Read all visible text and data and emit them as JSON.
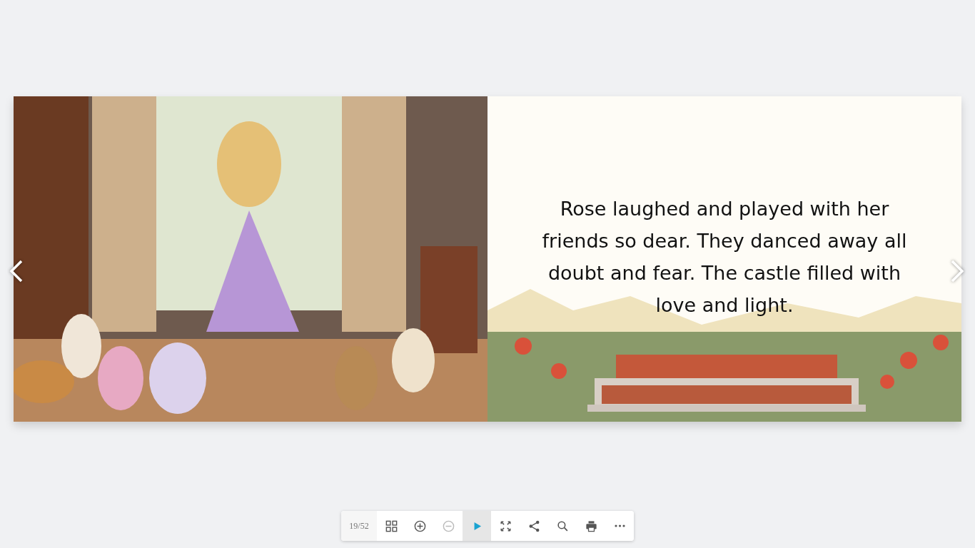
{
  "book": {
    "right_page": {
      "kind": "picture",
      "text": "Rose laughed and played with her friends so dear. They danced away all doubt and fear. The castle filled with love and light."
    }
  },
  "toolbar": {
    "page_counter": "19/52",
    "buttons": [
      {
        "kind": "grid",
        "disabled": false,
        "selected": false
      },
      {
        "kind": "zoom-in",
        "disabled": false,
        "selected": false
      },
      {
        "kind": "zoom-out",
        "disabled": true,
        "selected": false
      },
      {
        "kind": "play",
        "disabled": false,
        "selected": true
      },
      {
        "kind": "fullscreen",
        "disabled": false,
        "selected": false
      },
      {
        "kind": "share",
        "disabled": false,
        "selected": false
      },
      {
        "kind": "search",
        "disabled": false,
        "selected": false
      },
      {
        "kind": "print",
        "disabled": false,
        "selected": false
      },
      {
        "kind": "more",
        "disabled": false,
        "selected": false
      }
    ]
  }
}
